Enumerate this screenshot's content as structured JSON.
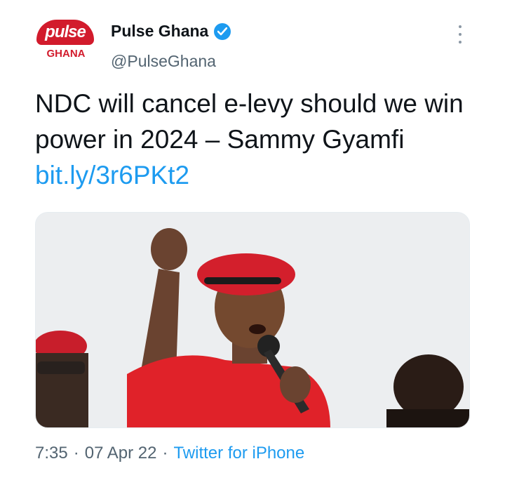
{
  "account": {
    "avatar_label": "pulse",
    "avatar_sub": "GHANA",
    "display_name": "Pulse Ghana",
    "handle": "@PulseGhana",
    "verified": true
  },
  "tweet": {
    "text": "NDC will cancel e-levy should we win power in 2024 – Sammy Gyamfi ",
    "link": "bit.ly/3r6PKt2"
  },
  "meta": {
    "time": "7:35",
    "separator": "·",
    "date": "07 Apr 22",
    "source": "Twitter for iPhone"
  },
  "colors": {
    "brand_red": "#d21b2c",
    "link_blue": "#1d9bf0",
    "muted": "#536471"
  },
  "icons": {
    "verified": "verified-badge-icon",
    "more": "more-options-icon"
  }
}
